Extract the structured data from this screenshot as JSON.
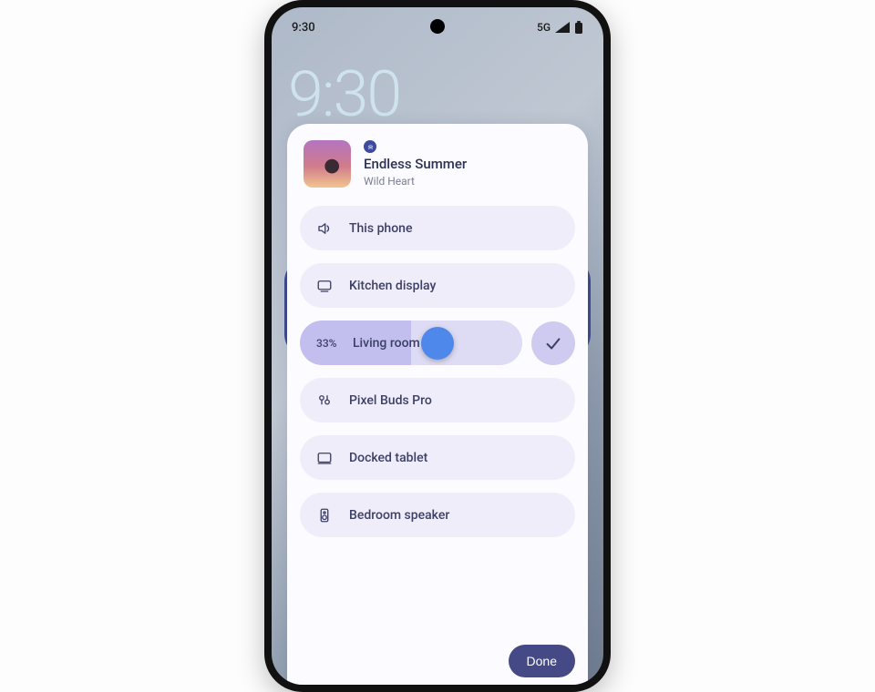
{
  "status": {
    "time": "9:30",
    "network": "5G"
  },
  "lockscreen": {
    "clock": "9:30"
  },
  "now_playing": {
    "title": "Endless Summer",
    "artist": "Wild Heart"
  },
  "devices": [
    {
      "label": "This phone"
    },
    {
      "label": "Kitchen display"
    },
    {
      "label": "Living room TV",
      "active": true,
      "level_pct_label": "33%",
      "level_fraction": 0.5,
      "thumb_fraction": 0.62
    },
    {
      "label": "Pixel Buds Pro"
    },
    {
      "label": "Docked tablet"
    },
    {
      "label": "Bedroom speaker"
    }
  ],
  "actions": {
    "done": "Done"
  }
}
